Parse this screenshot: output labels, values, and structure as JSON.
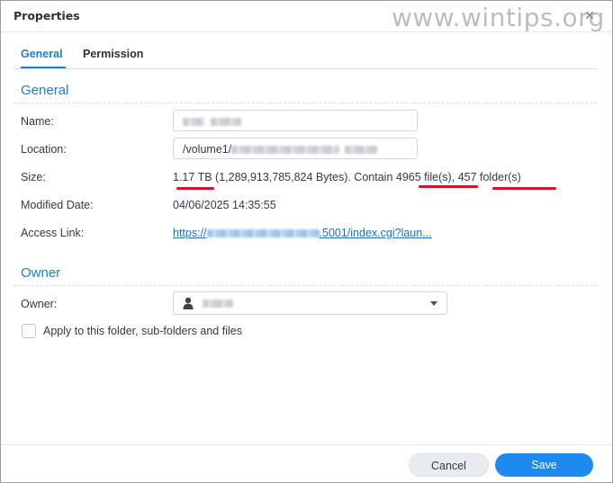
{
  "window": {
    "title": "Properties",
    "watermark": "www.wintips.org"
  },
  "tabs": [
    {
      "label": "General",
      "active": true
    },
    {
      "label": "Permission",
      "active": false
    }
  ],
  "general": {
    "section_title": "General",
    "name": {
      "label": "Name:",
      "value": ""
    },
    "location": {
      "label": "Location:",
      "value_prefix": "/volume1/"
    },
    "size": {
      "label": "Size:",
      "tb": "1.17 TB",
      "bytes_text": " (1,289,913,785,824 Bytes). Contain ",
      "files": "4965 file(s)",
      "sep": ", ",
      "folders": "457 folder(s)"
    },
    "modified": {
      "label": "Modified Date:",
      "value": "04/06/2025 14:35:55"
    },
    "access_link": {
      "label": "Access Link:",
      "prefix": "https://",
      "suffix": ".5001/index.cgi?laun..."
    }
  },
  "owner": {
    "section_title": "Owner",
    "label": "Owner:",
    "apply_label": "Apply to this folder, sub-folders and files",
    "apply_checked": false
  },
  "footer": {
    "cancel_label": "Cancel",
    "save_label": "Save"
  },
  "colors": {
    "accent": "#1c7fd6",
    "highlight": "#d9121f",
    "primary_button": "#1c8af0"
  }
}
